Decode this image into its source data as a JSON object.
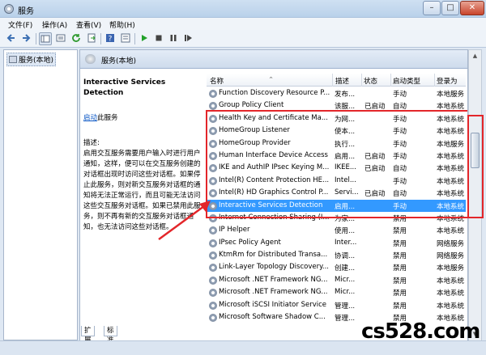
{
  "window": {
    "title": "服务",
    "minimize": "–",
    "maximize": "□",
    "close": "✕"
  },
  "menu": [
    {
      "label": "文件(F)"
    },
    {
      "label": "操作(A)"
    },
    {
      "label": "查看(V)"
    },
    {
      "label": "帮助(H)"
    }
  ],
  "toolbar": {
    "icons": [
      "back-icon",
      "forward-icon",
      "show-tree-icon",
      "list-icon",
      "refresh-icon",
      "export-icon",
      "help-icon",
      "properties-icon",
      "start-icon",
      "stop-icon",
      "pause-icon",
      "restart-icon"
    ]
  },
  "tree": {
    "node_label": "服务(本地)"
  },
  "main": {
    "header": "服务(本地)",
    "detail": {
      "service_title": "Interactive Services Detection",
      "start_link": "启动",
      "start_suffix": "此服务",
      "desc_label": "描述:",
      "desc_text": "启用交互服务需要用户输入时进行用户通知，这样，便可以在交互服务创建的对话框出现时访问这些对话框。如果停止此服务，则对新交互服务对话框的通知将无法正常运行，而且可能无法访问这些交互服务对话框。如果已禁用此服务，则不再有新的交互服务对话框通知，也无法访问这些对话框。"
    },
    "columns": {
      "name": "名称",
      "description": "描述",
      "status": "状态",
      "startup": "启动类型",
      "logon": "登录为"
    },
    "rows": [
      {
        "name": "Function Discovery Resource P...",
        "description": "发布...",
        "status": "",
        "startup": "手动",
        "logon": "本地服务"
      },
      {
        "name": "Group Policy Client",
        "description": "该服...",
        "status": "已启动",
        "startup": "自动",
        "logon": "本地系统"
      },
      {
        "name": "Health Key and Certificate Ma...",
        "description": "为网...",
        "status": "",
        "startup": "手动",
        "logon": "本地系统"
      },
      {
        "name": "HomeGroup Listener",
        "description": "使本...",
        "status": "",
        "startup": "手动",
        "logon": "本地系统"
      },
      {
        "name": "HomeGroup Provider",
        "description": "执行...",
        "status": "",
        "startup": "手动",
        "logon": "本地服务"
      },
      {
        "name": "Human Interface Device Access",
        "description": "启用...",
        "status": "已启动",
        "startup": "手动",
        "logon": "本地系统"
      },
      {
        "name": "IKE and AuthIP IPsec Keying M...",
        "description": "IKEE...",
        "status": "已启动",
        "startup": "自动",
        "logon": "本地系统"
      },
      {
        "name": "Intel(R) Content Protection HE...",
        "description": "Intel...",
        "status": "",
        "startup": "手动",
        "logon": "本地系统"
      },
      {
        "name": "Intel(R) HD Graphics Control P...",
        "description": "Servi...",
        "status": "已启动",
        "startup": "自动",
        "logon": "本地系统"
      },
      {
        "name": "Interactive Services Detection",
        "description": "启用...",
        "status": "",
        "startup": "手动",
        "logon": "本地系统",
        "selected": true
      },
      {
        "name": "Internet Connection Sharing (I...",
        "description": "为家...",
        "status": "",
        "startup": "禁用",
        "logon": "本地系统"
      },
      {
        "name": "IP Helper",
        "description": "使用...",
        "status": "",
        "startup": "禁用",
        "logon": "本地系统"
      },
      {
        "name": "IPsec Policy Agent",
        "description": "Inter...",
        "status": "",
        "startup": "禁用",
        "logon": "网络服务"
      },
      {
        "name": "KtmRm for Distributed Transa...",
        "description": "协调...",
        "status": "",
        "startup": "禁用",
        "logon": "网络服务"
      },
      {
        "name": "Link-Layer Topology Discovery...",
        "description": "创建...",
        "status": "",
        "startup": "禁用",
        "logon": "本地服务"
      },
      {
        "name": "Microsoft .NET Framework NG...",
        "description": "Micr...",
        "status": "",
        "startup": "禁用",
        "logon": "本地系统"
      },
      {
        "name": "Microsoft .NET Framework NG...",
        "description": "Micr...",
        "status": "",
        "startup": "禁用",
        "logon": "本地系统"
      },
      {
        "name": "Microsoft iSCSI Initiator Service",
        "description": "管理...",
        "status": "",
        "startup": "禁用",
        "logon": "本地系统"
      },
      {
        "name": "Microsoft Software Shadow C...",
        "description": "管理...",
        "status": "",
        "startup": "禁用",
        "logon": "本地系统"
      }
    ]
  },
  "tabs": [
    {
      "label": "扩展"
    },
    {
      "label": "标准"
    }
  ],
  "watermark": "cs528.com",
  "colors": {
    "selection": "#3399ff",
    "annotation": "#e3262a",
    "link": "#0b57c5"
  }
}
